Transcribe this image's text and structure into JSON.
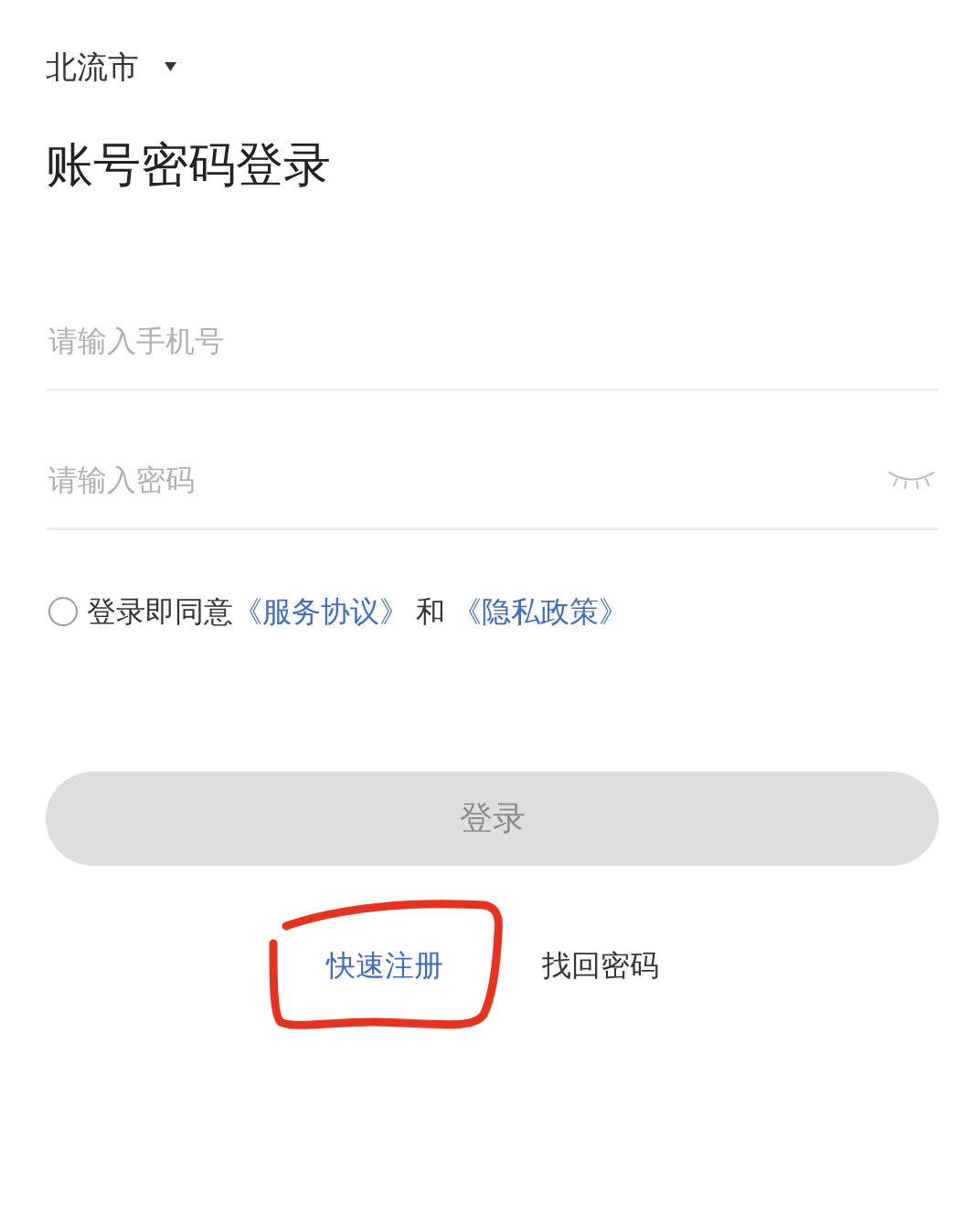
{
  "city_selector": {
    "label": "北流市"
  },
  "title": "账号密码登录",
  "fields": [
    {
      "kind": "phone",
      "placeholder": "请输入手机号"
    },
    {
      "kind": "password",
      "placeholder": "请输入密码"
    }
  ],
  "agreement": {
    "checked": false,
    "parts": [
      {
        "kind": "text",
        "text": "登录即同意"
      },
      {
        "kind": "link",
        "text": "《服务协议》"
      },
      {
        "kind": "text",
        "text": "和"
      },
      {
        "kind": "link",
        "text": "《隐私政策》"
      }
    ]
  },
  "login_button": {
    "label": "登录",
    "disabled": true
  },
  "links": [
    {
      "kind": "primary",
      "text": "快速注册",
      "circled": true
    },
    {
      "kind": "plain",
      "text": "找回密码",
      "circled": false
    }
  ]
}
